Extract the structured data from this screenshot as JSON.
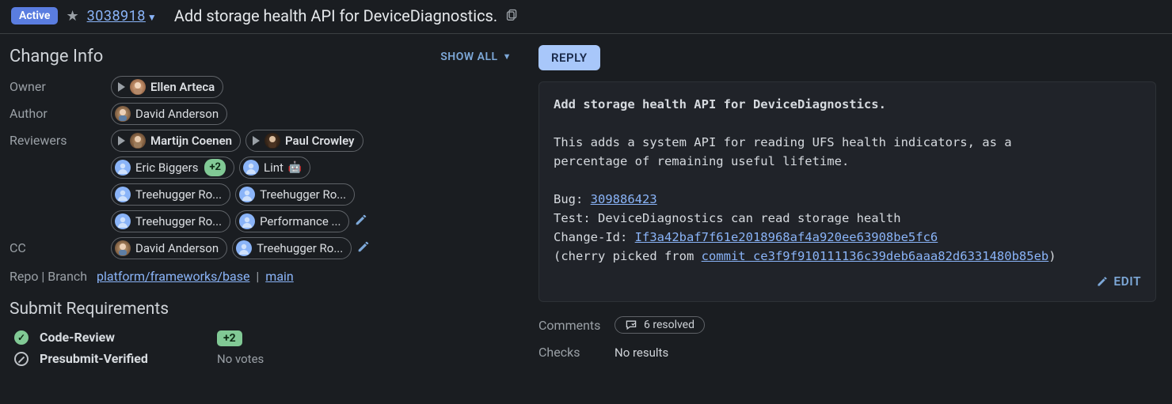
{
  "header": {
    "status": "Active",
    "change_number": "3038918",
    "title": "Add storage health API for DeviceDiagnostics."
  },
  "info": {
    "heading": "Change Info",
    "show_all": "SHOW ALL",
    "owner_label": "Owner",
    "author_label": "Author",
    "reviewers_label": "Reviewers",
    "cc_label": "CC",
    "repo_branch_label": "Repo | Branch",
    "owner": "Ellen Arteca",
    "author": "David Anderson",
    "reviewers": {
      "martijn": "Martijn Coenen",
      "paul": "Paul Crowley",
      "eric": "Eric Biggers",
      "eric_vote": "+2",
      "lint": "Lint",
      "th1": "Treehugger Ro...",
      "th2": "Treehugger Ro...",
      "th3": "Treehugger Ro...",
      "perf": "Performance ..."
    },
    "cc": {
      "david": "David Anderson",
      "th": "Treehugger Ro..."
    },
    "repo": "platform/frameworks/base",
    "branch": "main"
  },
  "submit": {
    "heading": "Submit Requirements",
    "code_review": "Code-Review",
    "code_review_val": "+2",
    "presubmit": "Presubmit-Verified",
    "presubmit_val": "No votes"
  },
  "right": {
    "reply": "REPLY",
    "desc_first": "Add storage health API for DeviceDiagnostics.",
    "desc_body": "This adds a system API for reading UFS health indicators, as a\npercentage of remaining useful lifetime.",
    "bug_label": "Bug: ",
    "bug_link": "309886423",
    "test_line": "Test: DeviceDiagnostics can read storage health",
    "changeid_label": "Change-Id: ",
    "changeid_link": "If3a42baf7f61e2018968af4a920ee63908be5fc6",
    "cherry_pre": "(cherry picked from ",
    "cherry_link": "commit ce3f9f910111136c39deb6aaa82d6331480b85eb",
    "cherry_post": ")",
    "edit": "EDIT",
    "comments_label": "Comments",
    "comments_val": "6 resolved",
    "checks_label": "Checks",
    "checks_val": "No results"
  }
}
